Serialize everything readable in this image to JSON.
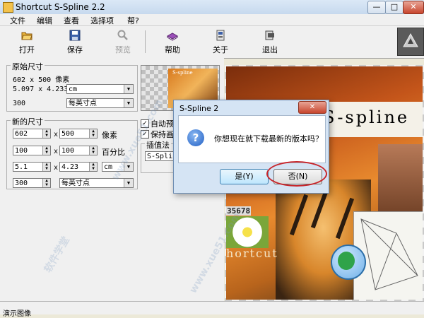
{
  "window": {
    "title": "Shortcut S-Spline 2.2",
    "min": "—",
    "max": "□",
    "close": "✕"
  },
  "menu": {
    "items": [
      "文件",
      "编辑",
      "查看",
      "选择项",
      "帮?"
    ]
  },
  "toolbar": {
    "open": "打开",
    "save": "保存",
    "preview": "预览",
    "help": "帮助",
    "about": "关于",
    "exit": "退出"
  },
  "original_size": {
    "title": "原始尺寸",
    "pixels": "602 x 500 像素",
    "physical": "5.097 x 4.233",
    "unit": "cm",
    "resolution": "300",
    "res_unit": "每英寸点"
  },
  "new_size": {
    "title": "新的尺寸",
    "width_px": "602",
    "height_px": "500",
    "px_unit": "像素",
    "width_pct": "100",
    "height_pct": "100",
    "pct_unit": "百分比",
    "width_phys": "5.1",
    "height_phys": "4.23",
    "phys_unit": "cm",
    "resolution": "300",
    "res_unit": "每英寸点",
    "x": "x"
  },
  "options": {
    "thumb_label": "S-spline",
    "auto_preview": "自动预览",
    "keep_ratio": "保持画面",
    "method_title": "插值法",
    "method_value": "S-Spline"
  },
  "canvas": {
    "banner": "S-spline",
    "number": "35678",
    "shortcut": "hortcut"
  },
  "dialog": {
    "title": "S-Spline 2",
    "close": "✕",
    "icon": "?",
    "message": "你想现在就下载最新的版本吗？",
    "yes": "是(Y)",
    "no": "否(N)"
  },
  "status": {
    "text": "演示图像"
  },
  "watermarks": [
    "软件学堂",
    "www.xue51.com"
  ],
  "colors": {
    "accent": "#c8262b",
    "dialog_bg": "#d5e4f4"
  }
}
